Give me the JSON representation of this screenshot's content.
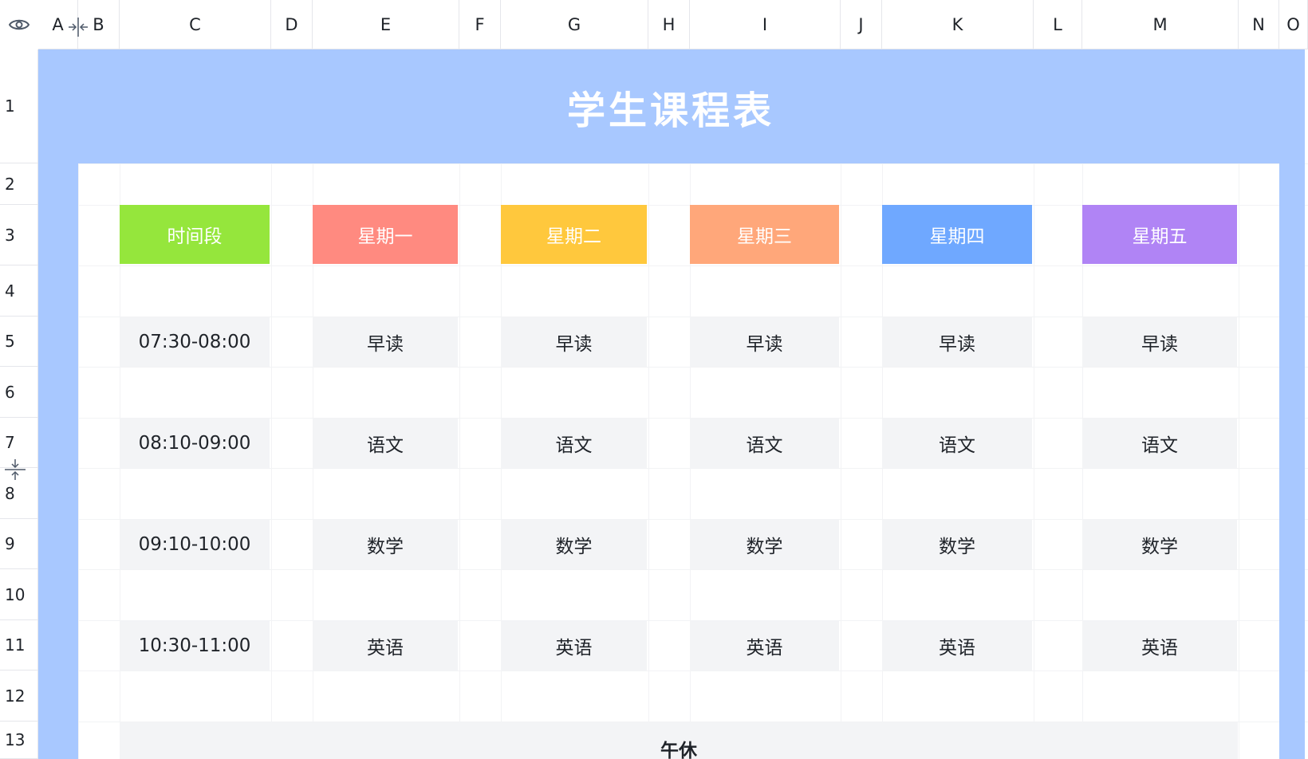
{
  "columns": [
    "A",
    "B",
    "C",
    "D",
    "E",
    "F",
    "G",
    "H",
    "I",
    "J",
    "K",
    "L",
    "M",
    "N",
    "O"
  ],
  "rows": [
    "1",
    "2",
    "3",
    "4",
    "5",
    "6",
    "7",
    "8",
    "9",
    "10",
    "11",
    "12",
    "13"
  ],
  "title": "学生课程表",
  "headers": {
    "time": "时间段",
    "mon": "星期一",
    "tue": "星期二",
    "wed": "星期三",
    "thu": "星期四",
    "fri": "星期五"
  },
  "schedule": [
    {
      "time": "07:30-08:00",
      "mon": "早读",
      "tue": "早读",
      "wed": "早读",
      "thu": "早读",
      "fri": "早读"
    },
    {
      "time": "08:10-09:00",
      "mon": "语文",
      "tue": "语文",
      "wed": "语文",
      "thu": "语文",
      "fri": "语文"
    },
    {
      "time": "09:10-10:00",
      "mon": "数学",
      "tue": "数学",
      "wed": "数学",
      "thu": "数学",
      "fri": "数学"
    },
    {
      "time": "10:30-11:00",
      "mon": "英语",
      "tue": "英语",
      "wed": "英语",
      "thu": "英语",
      "fri": "英语"
    }
  ],
  "lunch": "午休",
  "colors": {
    "frame": "#a8c8ff",
    "time_header": "#95e63c",
    "mon_header": "#ff8a80",
    "tue_header": "#ffc83d",
    "wed_header": "#ffa77a",
    "thu_header": "#6fa8ff",
    "fri_header": "#b084f5",
    "cell_bg": "#f3f4f6"
  },
  "icons": {
    "corner": "eye-icon",
    "column_resize": "column-resize-icon",
    "row_resize": "row-resize-icon"
  }
}
